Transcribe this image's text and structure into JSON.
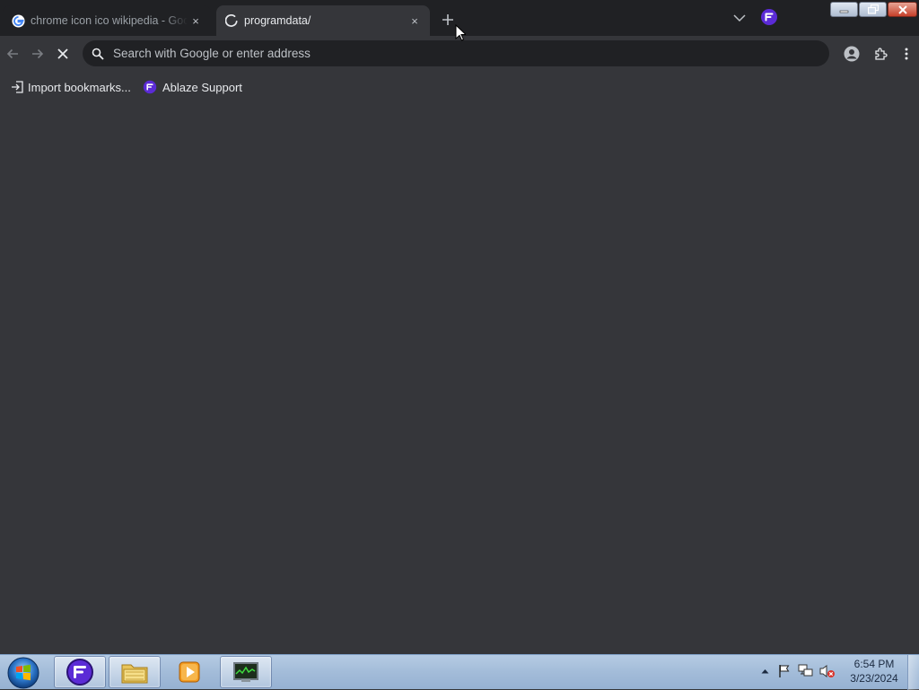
{
  "tabs": [
    {
      "title": "chrome icon ico wikipedia - Google",
      "favicon": "google-g-icon",
      "close": "×"
    },
    {
      "title": "programdata/",
      "favicon": "loading-spinner-icon",
      "close": "×"
    }
  ],
  "toolbar": {
    "omnibox_placeholder": "Search with Google or enter address",
    "back": "back-arrow-icon",
    "forward": "forward-arrow-icon",
    "stop": "stop-loading-icon"
  },
  "bookmarks": [
    {
      "label": "Import bookmarks...",
      "icon": "import-icon"
    },
    {
      "label": "Ablaze Support",
      "icon": "ablaze-logo-icon"
    }
  ],
  "taskbar": {
    "apps": [
      "ablaze-floorp-browser",
      "windows-explorer",
      "media-player",
      "task-manager"
    ],
    "clock": {
      "time": "6:54 PM",
      "date": "3/23/2024"
    }
  },
  "colors": {
    "tabstrip": "#202124",
    "toolbar": "#35363a",
    "omnibox": "#202124",
    "ablaze_purple": "#5b2bd6"
  }
}
